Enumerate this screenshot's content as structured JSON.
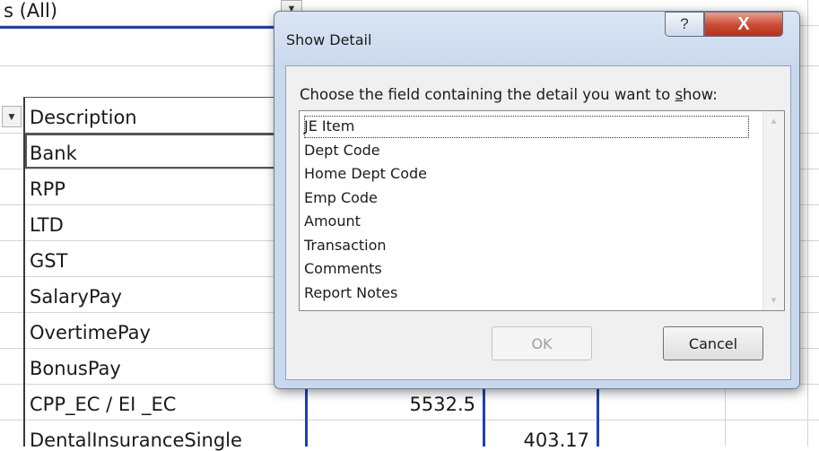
{
  "sheet": {
    "page_filter_value": "s (All)",
    "header": "Description",
    "rows": [
      {
        "description": "Bank"
      },
      {
        "description": "RPP"
      },
      {
        "description": "LTD"
      },
      {
        "description": "GST"
      },
      {
        "description": "SalaryPay"
      },
      {
        "description": "OvertimePay"
      },
      {
        "description": "BonusPay"
      },
      {
        "description": "CPP_EC / EI _EC",
        "value1": "5532.5"
      },
      {
        "description": "DentalInsuranceSingle",
        "value2": "403.17"
      }
    ]
  },
  "dialog": {
    "title": "Show Detail",
    "help_glyph": "?",
    "close_glyph": "X",
    "prompt_before": "Choose the field containing the detail you want to ",
    "prompt_accel": "s",
    "prompt_after": "how:",
    "fields": [
      "JE Item",
      "Dept Code",
      "Home Dept Code",
      "Emp Code",
      "Amount",
      "Transaction",
      "Comments",
      "Report Notes"
    ],
    "ok_label": "OK",
    "cancel_label": "Cancel"
  },
  "colors": {
    "pivot_border": "#1f3fb5",
    "dialog_frame": "#c9d8ec",
    "close_button": "#c94a33"
  },
  "icons": {
    "help": "question-mark-icon",
    "close": "close-icon",
    "filter": "filter-funnel-icon",
    "scroll_up": "scroll-up-arrow-icon",
    "scroll_down": "scroll-down-arrow-icon"
  }
}
